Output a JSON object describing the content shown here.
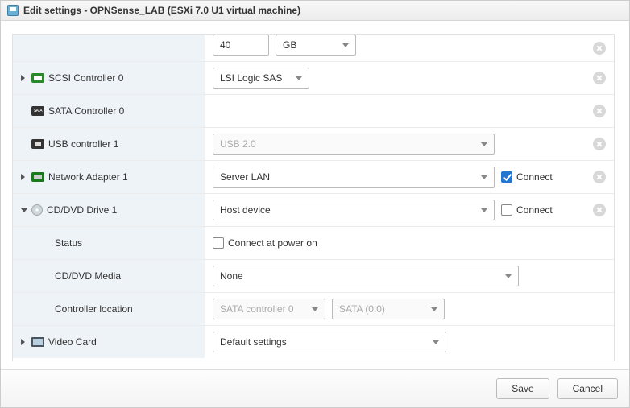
{
  "title": "Edit settings - OPNSense_LAB (ESXi 7.0 U1 virtual machine)",
  "rows": {
    "hdd": {
      "size": "40",
      "unit": "GB"
    },
    "scsi": {
      "label": "SCSI Controller 0",
      "type": "LSI Logic SAS"
    },
    "sata": {
      "label": "SATA Controller 0"
    },
    "usb": {
      "label": "USB controller 1",
      "type": "USB 2.0"
    },
    "net": {
      "label": "Network Adapter 1",
      "network": "Server LAN",
      "connect": "Connect"
    },
    "cd": {
      "label": "CD/DVD Drive 1",
      "src": "Host device",
      "connect": "Connect"
    },
    "cd_status": {
      "label": "Status",
      "option": "Connect at power on"
    },
    "cd_media": {
      "label": "CD/DVD Media",
      "value": "None"
    },
    "cd_ctrl": {
      "label": "Controller location",
      "bus": "SATA controller 0",
      "slot": "SATA (0:0)"
    },
    "video": {
      "label": "Video Card",
      "value": "Default settings"
    }
  },
  "footer": {
    "save": "Save",
    "cancel": "Cancel"
  }
}
